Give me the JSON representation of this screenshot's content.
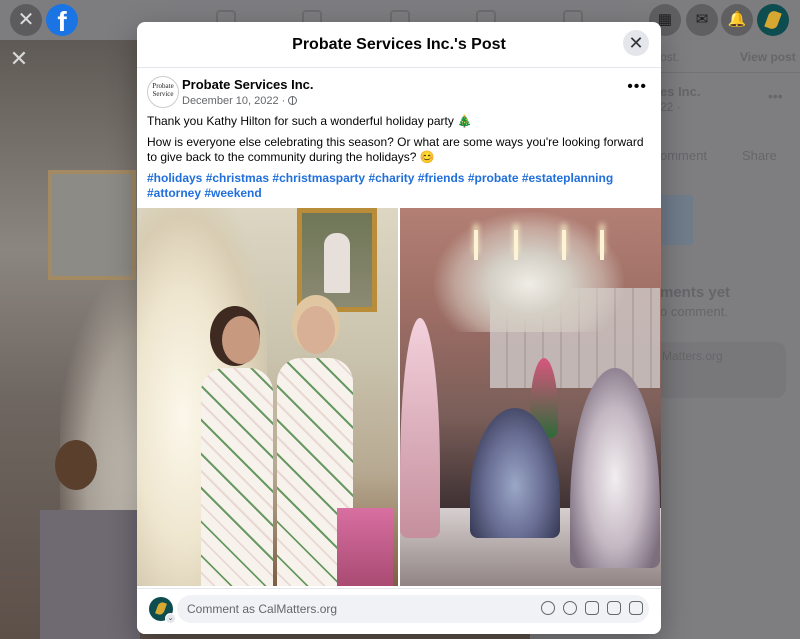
{
  "topbar": {
    "close_glyph": "✕",
    "logo": "f",
    "menu_icon": "menu-grid-icon",
    "messenger_icon": "messenger-icon",
    "notifications_icon": "bell-icon"
  },
  "background": {
    "close_glyph": "✕",
    "right_panel": {
      "line1": "ost.",
      "view_post": "View post",
      "page_name_fragment": "es Inc.",
      "date_fragment": "22 ·",
      "comment_fragment": "omment",
      "share": "Share",
      "no_comments": "ments yet",
      "to_comment": "o comment.",
      "commenter": "Matters.org"
    }
  },
  "modal": {
    "title": "Probate Services Inc.'s Post",
    "close_glyph": "✕",
    "post": {
      "avatar_text": "Probate Service",
      "page_name": "Probate Services Inc.",
      "date": "December 10, 2022 ·",
      "more_glyph": "•••",
      "line1": "Thank you Kathy Hilton for such a wonderful holiday party 🎄",
      "line2": "How is everyone else celebrating this season? Or what are some ways you're looking forward to give back to the community during the holidays? 😊",
      "hashtags": "#holidays #christmas #christmasparty #charity #friends #probate #estateplanning #attorney #weekend"
    },
    "comment": {
      "placeholder": "Comment as CalMatters.org",
      "badge_glyph": "⌄"
    }
  },
  "colors": {
    "facebook_blue": "#1b74e4",
    "hashtag_blue": "#216fdb",
    "overlay": "#7f7f82"
  }
}
